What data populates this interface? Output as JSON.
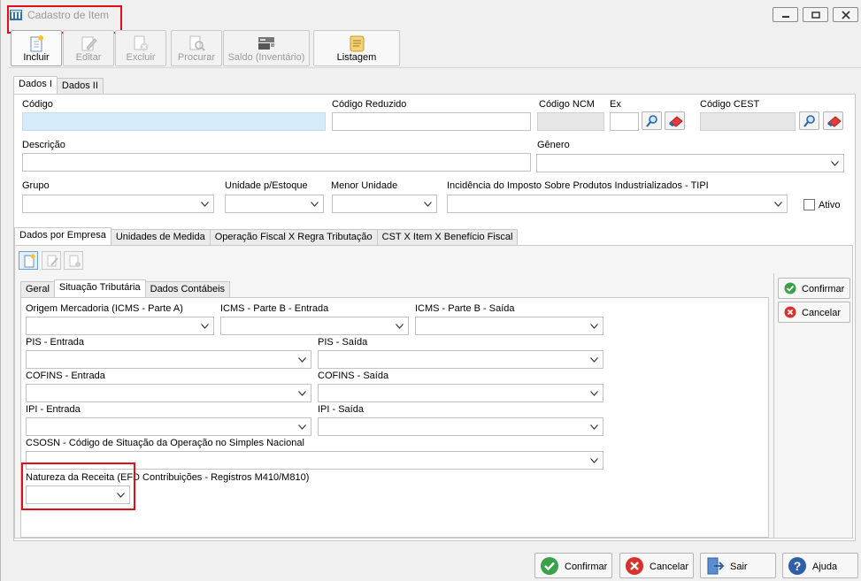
{
  "window": {
    "title": "Cadastro de Item"
  },
  "toolbar": {
    "incluir": "Incluir",
    "editar": "Editar",
    "excluir": "Excluir",
    "procurar": "Procurar",
    "saldo": "Saldo (Inventário)",
    "listagem": "Listagem"
  },
  "main_tabs": [
    "Dados I",
    "Dados II"
  ],
  "fields": {
    "codigo": {
      "label": "Código",
      "value": ""
    },
    "codigo_reduzido": {
      "label": "Código Reduzido",
      "value": ""
    },
    "codigo_ncm": {
      "label": "Código NCM",
      "value": ""
    },
    "ex": {
      "label": "Ex",
      "value": ""
    },
    "codigo_cest": {
      "label": "Código CEST",
      "value": ""
    },
    "descricao": {
      "label": "Descrição",
      "value": ""
    },
    "genero": {
      "label": "Gênero",
      "value": ""
    },
    "grupo": {
      "label": "Grupo",
      "value": ""
    },
    "unidade_estoque": {
      "label": "Unidade p/Estoque",
      "value": ""
    },
    "menor_unidade": {
      "label": "Menor Unidade",
      "value": ""
    },
    "tipi": {
      "label": "Incidência do Imposto Sobre Produtos Industrializados - TIPI",
      "value": ""
    },
    "ativo": {
      "label": "Ativo",
      "checked": false
    }
  },
  "sub_tabs": [
    "Dados por Empresa",
    "Unidades de Medida",
    "Operação Fiscal X Regra Tributação",
    "CST X Item X Benefício Fiscal"
  ],
  "inner_tabs": [
    "Geral",
    "Situação Tributária",
    "Dados Contábeis"
  ],
  "tributaria": {
    "origem": {
      "label": "Origem Mercadoria (ICMS - Parte A)",
      "value": ""
    },
    "icms_b_entrada": {
      "label": "ICMS - Parte B - Entrada",
      "value": ""
    },
    "icms_b_saida": {
      "label": "ICMS - Parte B - Saída",
      "value": ""
    },
    "pis_entrada": {
      "label": "PIS - Entrada",
      "value": ""
    },
    "pis_saida": {
      "label": "PIS - Saída",
      "value": ""
    },
    "cofins_entrada": {
      "label": "COFINS - Entrada",
      "value": ""
    },
    "cofins_saida": {
      "label": "COFINS - Saída",
      "value": ""
    },
    "ipi_entrada": {
      "label": "IPI - Entrada",
      "value": ""
    },
    "ipi_saida": {
      "label": "IPI - Saída",
      "value": ""
    },
    "csosn": {
      "label": "CSOSN - Código de Situação da Operação no Simples Nacional",
      "value": ""
    },
    "natureza": {
      "label": "Natureza da Receita (EFD Contribuições - Registros M410/M810)",
      "value": ""
    }
  },
  "side_actions": {
    "confirmar": "Confirmar",
    "cancelar": "Cancelar"
  },
  "bottom_actions": {
    "confirmar": "Confirmar",
    "cancelar": "Cancelar",
    "sair": "Sair",
    "ajuda": "Ajuda"
  },
  "colors": {
    "highlight": "#e0101a",
    "code_field": "#d5ebfa",
    "confirm": "#3aa04a",
    "cancel": "#d9312b",
    "help": "#2e5fa8"
  }
}
